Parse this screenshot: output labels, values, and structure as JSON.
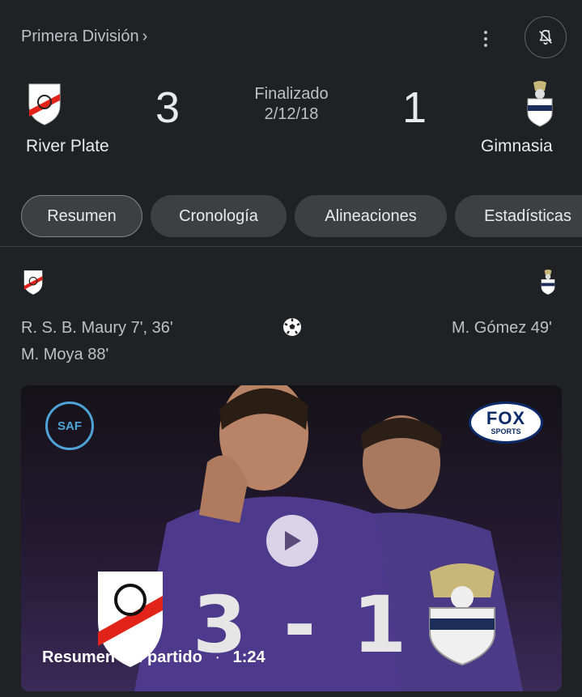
{
  "header": {
    "league": "Primera División",
    "league_chevron": "›",
    "icons": [
      "more-vert-icon",
      "notification-bell-icon"
    ]
  },
  "match": {
    "home_team": "River Plate",
    "away_team": "Gimnasia",
    "home_score": "3",
    "away_score": "1",
    "status": "Finalizado",
    "date": "2/12/18"
  },
  "tabs": [
    {
      "label": "Resumen",
      "active": true
    },
    {
      "label": "Cronología",
      "active": false
    },
    {
      "label": "Alineaciones",
      "active": false
    },
    {
      "label": "Estadísticas",
      "active": false
    }
  ],
  "goals": {
    "home": [
      "R. S. B. Maury 7', 36'",
      "M. Moya 88'"
    ],
    "away": [
      "M. Gómez 49'"
    ],
    "icon": "soccer-ball-icon"
  },
  "video": {
    "title": "Resumen del partido",
    "separator": "·",
    "duration": "1:24",
    "overlay_score": "3 - 1",
    "broadcaster": "FOX",
    "broadcaster_sub": "SPORTS",
    "league_logo": "SAF"
  },
  "colors": {
    "background": "#202124",
    "chip": "#3c4043",
    "text": "#e8eaed",
    "muted": "#bdc1c6",
    "river_red": "#e2231a"
  }
}
